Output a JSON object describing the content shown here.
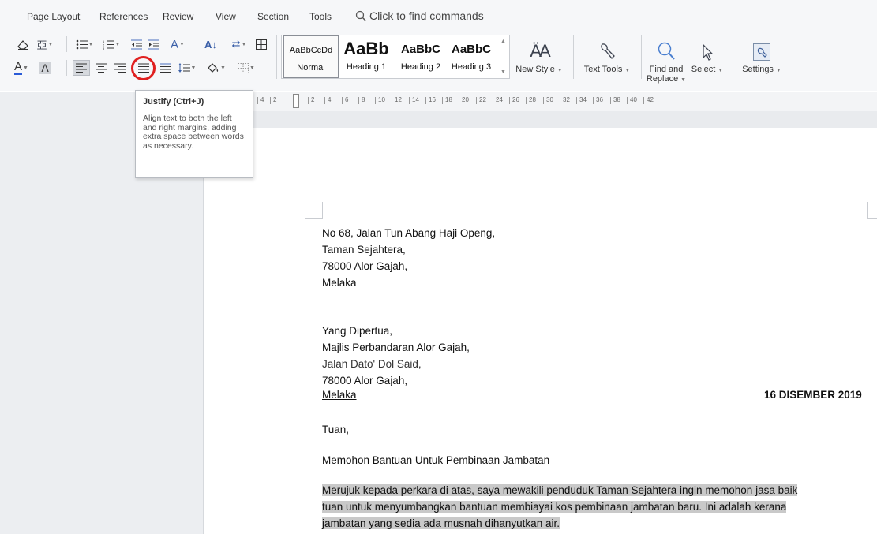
{
  "menu_tabs": [
    "Page Layout",
    "References",
    "Review",
    "View",
    "Section",
    "Tools"
  ],
  "search": {
    "label": "Click to find commands"
  },
  "styles": {
    "normal": {
      "sample": "AaBbCcDd",
      "name": "Normal"
    },
    "heading1": {
      "sample": "AaBb",
      "name": "Heading 1"
    },
    "heading2": {
      "sample": "AaBbC",
      "name": "Heading 2"
    },
    "heading3": {
      "sample": "AaBbC",
      "name": "Heading 3"
    }
  },
  "tools": {
    "new_style": "New Style",
    "text_tools": "Text Tools",
    "find_replace_line1": "Find and",
    "find_replace_line2": "Replace",
    "select": "Select",
    "settings": "Settings"
  },
  "tooltip": {
    "title": "Justify (Ctrl+J)",
    "body": "Align text to both the left and right margins, adding extra space between words as necessary."
  },
  "ruler": [
    "4",
    "2",
    "2",
    "4",
    "6",
    "8",
    "10",
    "12",
    "14",
    "16",
    "18",
    "20",
    "22",
    "24",
    "26",
    "28",
    "30",
    "32",
    "34",
    "36",
    "38",
    "40",
    "42"
  ],
  "letter": {
    "sender": [
      "No 68, Jalan Tun Abang Haji Openg,",
      "Taman Sejahtera,",
      "78000 Alor Gajah,",
      "Melaka"
    ],
    "recipient": [
      "Yang Dipertua,",
      "Majlis Perbandaran Alor Gajah,",
      "Jalan Dato' Dol Said,",
      "78000 Alor Gajah,",
      "Melaka"
    ],
    "date": "16 DISEMBER 2019",
    "salutation": "Tuan,",
    "subject": "Memohon Bantuan Untuk Pembinaan Jambatan",
    "body": [
      "Merujuk kepada perkara di atas, saya mewakili penduduk Taman Sejahtera ingin memohon jasa baik",
      "tuan untuk menyumbangkan bantuan membiayai kos pembinaan jambatan baru. Ini adalah kerana",
      "jambatan yang sedia ada musnah dihanyutkan air. "
    ]
  },
  "colors": {
    "highlight_marker": "#e02020",
    "text_highlight": "#c9c9c9"
  }
}
